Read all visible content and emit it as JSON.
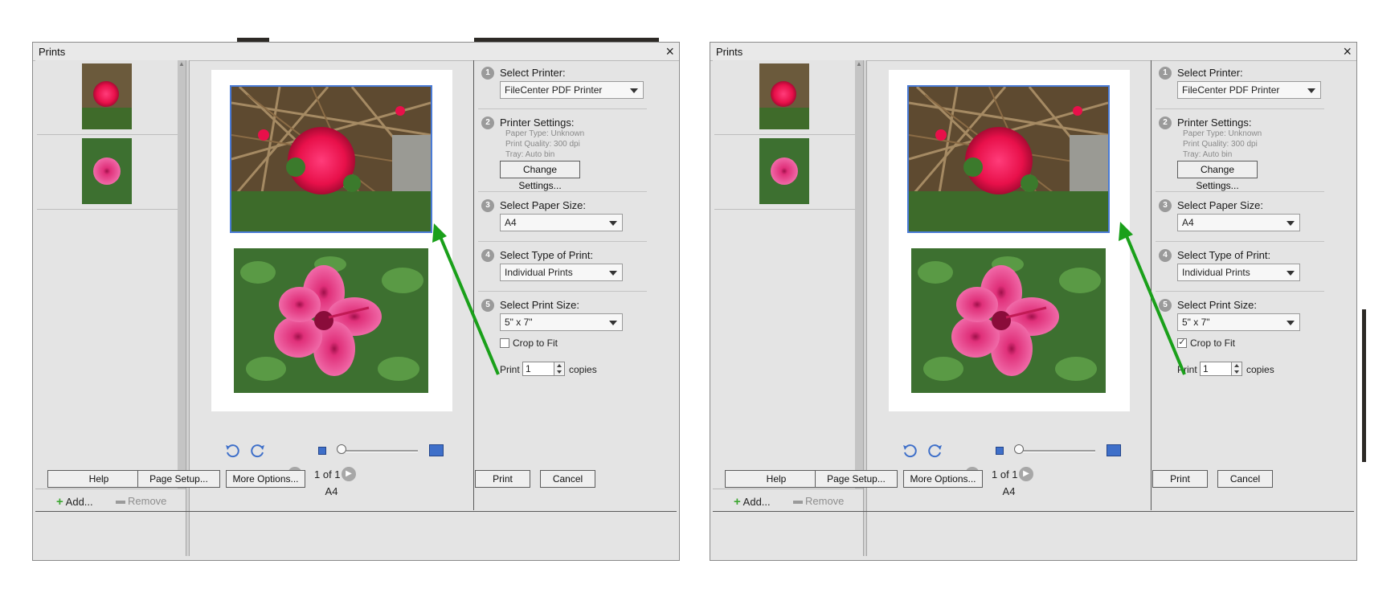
{
  "dialogs": [
    {
      "title": "Prints",
      "close": "×",
      "add_label": "Add...",
      "remove_label": "Remove",
      "pager": {
        "prev": "◀",
        "text": "1 of 1",
        "next": "▶"
      },
      "paper_name": "A4",
      "step_numbers": [
        "1",
        "2",
        "3",
        "4",
        "5"
      ],
      "select_printer_label": "Select Printer:",
      "printer_value": "FileCenter PDF Printer",
      "printer_settings_label": "Printer Settings:",
      "paper_type": "Paper Type: Unknown",
      "print_quality": "Print Quality: 300 dpi",
      "tray": "Tray: Auto bin",
      "change_settings": "Change Settings...",
      "paper_size_label": "Select Paper Size:",
      "paper_size_value": "A4",
      "type_label": "Select Type of Print:",
      "type_value": "Individual Prints",
      "print_size_label": "Select Print Size:",
      "print_size_value": "5\" x 7\"",
      "crop_label": "Crop to Fit",
      "crop_checked": false,
      "crop_mark": "",
      "print_word": "Print",
      "copies_value": "1",
      "copies_word": "copies",
      "buttons": {
        "help": "Help",
        "page_setup": "Page Setup...",
        "more_options": "More Options...",
        "print": "Print",
        "cancel": "Cancel"
      }
    },
    {
      "title": "Prints",
      "close": "×",
      "add_label": "Add...",
      "remove_label": "Remove",
      "pager": {
        "prev": "◀",
        "text": "1 of 1",
        "next": "▶"
      },
      "paper_name": "A4",
      "step_numbers": [
        "1",
        "2",
        "3",
        "4",
        "5"
      ],
      "select_printer_label": "Select Printer:",
      "printer_value": "FileCenter PDF Printer",
      "printer_settings_label": "Printer Settings:",
      "paper_type": "Paper Type: Unknown",
      "print_quality": "Print Quality: 300 dpi",
      "tray": "Tray: Auto bin",
      "change_settings": "Change Settings...",
      "paper_size_label": "Select Paper Size:",
      "paper_size_value": "A4",
      "type_label": "Select Type of Print:",
      "type_value": "Individual Prints",
      "print_size_label": "Select Print Size:",
      "print_size_value": "5\" x 7\"",
      "crop_label": "Crop to Fit",
      "crop_checked": true,
      "crop_mark": "✓",
      "print_word": "Print",
      "copies_value": "1",
      "copies_word": "copies",
      "buttons": {
        "help": "Help",
        "page_setup": "Page Setup...",
        "more_options": "More Options...",
        "print": "Print",
        "cancel": "Cancel"
      }
    }
  ],
  "colors": {
    "annotation_arrow": "#1aa01a",
    "selection_outline": "#4a7bd6",
    "zoom_icon": "#3e6fc9"
  }
}
